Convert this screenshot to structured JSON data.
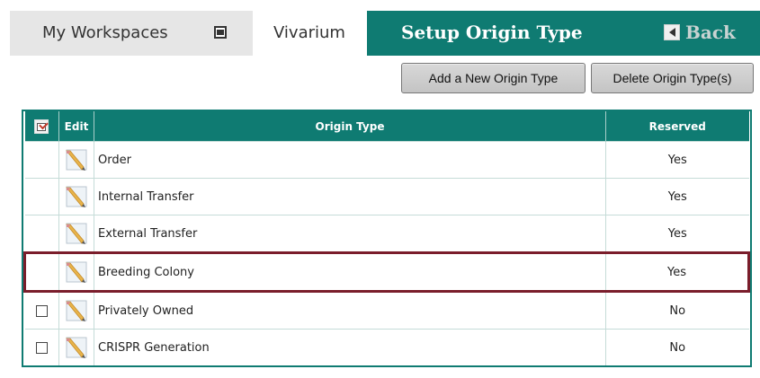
{
  "header": {
    "workspaces_label": "My Workspaces",
    "vivarium_label": "Vivarium",
    "page_title": "Setup Origin Type",
    "back_label": "Back"
  },
  "toolbar": {
    "add_label": "Add a New Origin Type",
    "delete_label": "Delete Origin Type(s)"
  },
  "table": {
    "columns": {
      "select": "",
      "edit": "Edit",
      "origin_type": "Origin Type",
      "reserved": "Reserved"
    },
    "rows": [
      {
        "origin_type": "Order",
        "reserved": "Yes",
        "has_checkbox": false,
        "highlighted": false
      },
      {
        "origin_type": "Internal Transfer",
        "reserved": "Yes",
        "has_checkbox": false,
        "highlighted": false
      },
      {
        "origin_type": "External Transfer",
        "reserved": "Yes",
        "has_checkbox": false,
        "highlighted": false
      },
      {
        "origin_type": "Breeding Colony",
        "reserved": "Yes",
        "has_checkbox": false,
        "highlighted": true
      },
      {
        "origin_type": "Privately Owned",
        "reserved": "No",
        "has_checkbox": true,
        "highlighted": false
      },
      {
        "origin_type": "CRISPR Generation",
        "reserved": "No",
        "has_checkbox": true,
        "highlighted": false
      }
    ]
  },
  "colors": {
    "teal": "#0f7b72",
    "highlight_border": "#7a1d2b",
    "tab_gray": "#e6e6e6"
  },
  "icons": {
    "dropdown": "dropdown-square-icon",
    "back": "back-arrow-icon",
    "header_check": "select-all-icon",
    "edit": "pencil-edit-icon"
  }
}
